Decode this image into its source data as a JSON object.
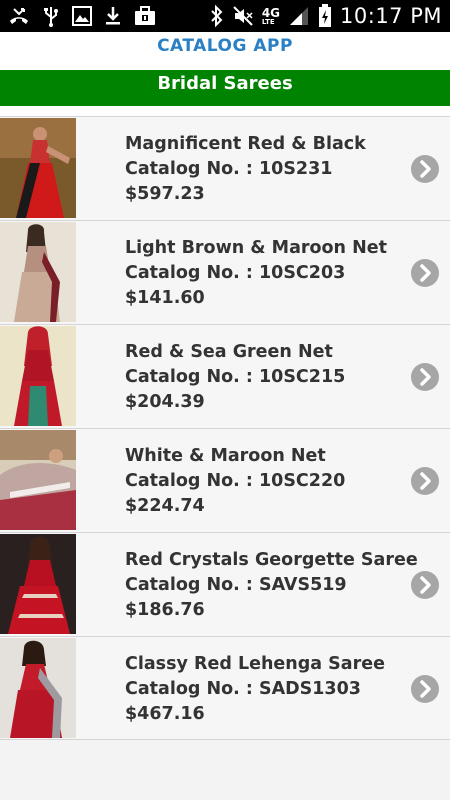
{
  "status_bar": {
    "time": "10:17 PM",
    "network": "4G",
    "network_sub": "LTE",
    "left_icons": [
      "missed-call-icon",
      "usb-icon",
      "image-icon",
      "download-icon",
      "briefcase-icon"
    ],
    "right_icons": [
      "bluetooth-icon",
      "mute-icon",
      "signal-icon",
      "battery-icon"
    ]
  },
  "app": {
    "title": "CATALOG APP"
  },
  "category": {
    "title": "Bridal Sarees"
  },
  "items": [
    {
      "name": "Magnificent Red & Black",
      "catalog": "Catalog No. : 10S231",
      "price": "$597.23"
    },
    {
      "name": "Light Brown & Maroon Net",
      "catalog": "Catalog No. : 10SC203",
      "price": "$141.60"
    },
    {
      "name": "Red & Sea Green Net",
      "catalog": "Catalog No. : 10SC215",
      "price": "$204.39"
    },
    {
      "name": "White & Maroon Net",
      "catalog": "Catalog No. : 10SC220",
      "price": "$224.74"
    },
    {
      "name": "Red Crystals Georgette Saree",
      "catalog": "Catalog No. : SAVS519",
      "price": "$186.76"
    },
    {
      "name": "Classy Red Lehenga Saree",
      "catalog": "Catalog No. : SADS1303",
      "price": "$467.16"
    }
  ],
  "colors": {
    "header_text": "#2a80c5",
    "category_bar": "#008300",
    "chevron": "#a6a6a6"
  }
}
